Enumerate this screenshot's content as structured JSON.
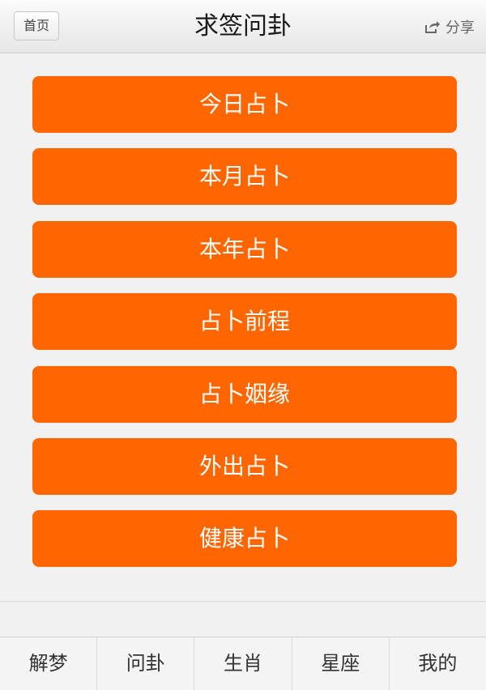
{
  "header": {
    "home_label": "首页",
    "title": "求签问卦",
    "share_label": "分享",
    "share_icon": "share-icon"
  },
  "menu": {
    "items": [
      {
        "label": "今日占卜"
      },
      {
        "label": "本月占卜"
      },
      {
        "label": "本年占卜"
      },
      {
        "label": "占卜前程"
      },
      {
        "label": "占卜姻缘"
      },
      {
        "label": "外出占卜"
      },
      {
        "label": "健康占卜"
      }
    ]
  },
  "tabbar": {
    "tabs": [
      {
        "label": "解梦"
      },
      {
        "label": "问卦"
      },
      {
        "label": "生肖"
      },
      {
        "label": "星座"
      },
      {
        "label": "我的"
      }
    ]
  },
  "colors": {
    "accent": "#ff6600",
    "background": "#f1f1f1"
  }
}
